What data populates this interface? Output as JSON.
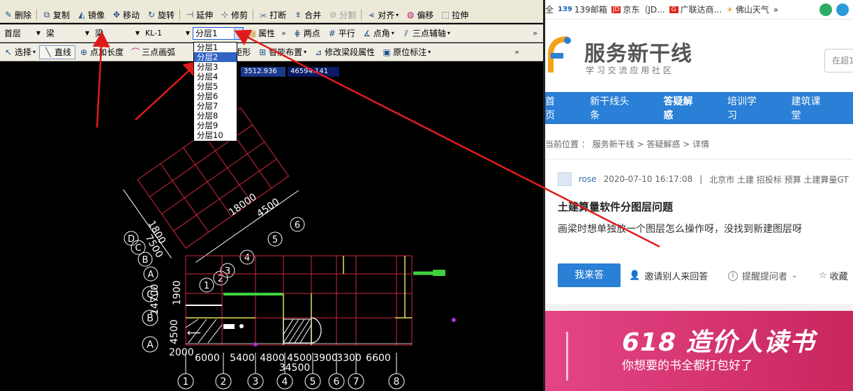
{
  "cad": {
    "toolbar1": [
      {
        "icon": "delete-icon",
        "label": "删除"
      },
      {
        "icon": "copy-icon",
        "label": "复制"
      },
      {
        "icon": "mirror-icon",
        "label": "镜像"
      },
      {
        "icon": "move-icon",
        "label": "移动"
      },
      {
        "icon": "rotate-icon",
        "label": "旋转"
      },
      {
        "icon": "extend-icon",
        "label": "延伸"
      },
      {
        "icon": "trim-icon",
        "label": "修剪"
      },
      {
        "icon": "break-icon",
        "label": "打断"
      },
      {
        "icon": "merge-icon",
        "label": "合并"
      },
      {
        "icon": "split-icon",
        "label": "分割"
      },
      {
        "icon": "align-icon",
        "label": "对齐"
      },
      {
        "icon": "offset-icon",
        "label": "偏移"
      },
      {
        "icon": "stretch-icon",
        "label": "拉伸"
      }
    ],
    "toolbar2": {
      "floor": "首层",
      "category": "梁",
      "type": "梁",
      "element": "KL-1",
      "layer": "分层1",
      "properties": "属性",
      "two_points": "两点",
      "parallel": "平行",
      "point_angle": "点角",
      "three_point_aux": "三点辅轴"
    },
    "toolbar3": {
      "select": "选择",
      "line": "直线",
      "point_length": "点加长度",
      "three_point_arc": "三点画弧",
      "rect": "矩形",
      "smart_layout": "智能布置",
      "modify_segment": "修改梁段属性",
      "original_label": "原位标注"
    },
    "layer_options": [
      "分层1",
      "分层2",
      "分层3",
      "分层4",
      "分层5",
      "分层6",
      "分层7",
      "分层8",
      "分层9",
      "分层10"
    ],
    "layer_selected_index": 1,
    "coord_x": "3512.936",
    "coord_y": "46594.141",
    "drawing": {
      "axis_numbers": [
        "1",
        "2",
        "3",
        "4",
        "5",
        "6",
        "7",
        "8"
      ],
      "axis_letters": [
        "A",
        "B",
        "C",
        "D"
      ],
      "bottom_dims": [
        "6000",
        "5400",
        "4800",
        "4500",
        "3900",
        "3300",
        "6600"
      ],
      "total_dim": "34500",
      "dim_2000": "2000",
      "left_dims": "4500",
      "rot_dims": "18000",
      "rot_dim_top": "4500",
      "rot_axes": [
        "1",
        "2",
        "3",
        "4",
        "5",
        "6"
      ],
      "rot_letters": [
        "A",
        "B",
        "C",
        "D"
      ],
      "left_vertical": "14700",
      "left_small": "1900",
      "left_small2": "7500",
      "left_top": "1800"
    }
  },
  "web": {
    "bookmarks": [
      "全",
      "139邮箱",
      "京东（JD...",
      "广联达商...",
      "佛山天气",
      "»"
    ],
    "logo_title": "服务新干线",
    "logo_sub": "学 习 交 流 应 用 社 区",
    "search_placeholder": "在超1",
    "nav": [
      "首页",
      "新干线头条",
      "答疑解惑",
      "培训学习",
      "建筑课堂"
    ],
    "nav_current": "答疑解惑",
    "breadcrumb": "当前位置 ： 服务新干线 > 答疑解惑 > 详情",
    "author": "rose",
    "post_time": "2020-07-10 16:17:08",
    "divider": "|",
    "location_tags": "北京市  土建  招投标  预算  土建算量GT",
    "question_title": "土建算量软件分图层问题",
    "question_body": "画梁时想单独放一个图层怎么操作呀，没找到新建图层呀",
    "answer_button": "我来答",
    "invite": "邀请别人来回答",
    "remind": "提醒提问者",
    "collect": "收藏",
    "banner_title": "618 造价人读书",
    "banner_sub": "你想要的书全都打包好了",
    "colors": {
      "nav": "#2a7fd6",
      "button": "#2a7fd6",
      "banner": "#d8336f",
      "arrow": "#e01b1b"
    }
  }
}
